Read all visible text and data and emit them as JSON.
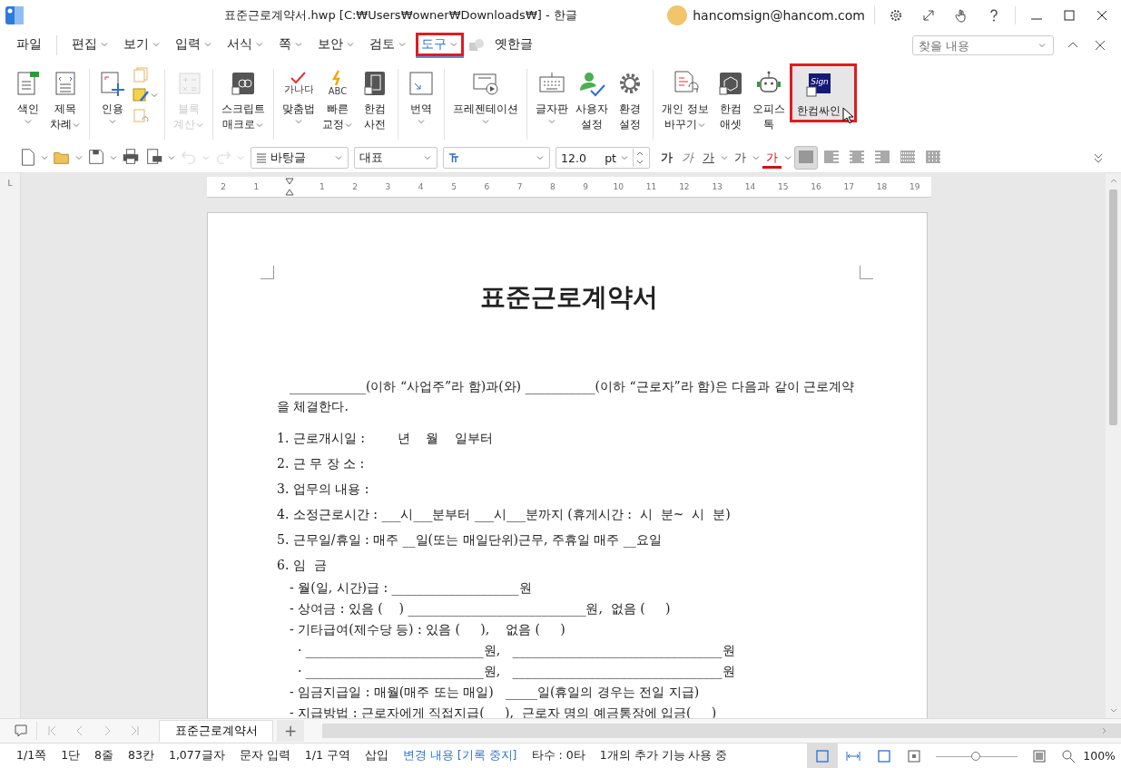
{
  "window": {
    "title": "표준근로계약서.hwp [C:₩Users₩owner₩Downloads₩] - 한글",
    "account": "hancomsign@hancom.com"
  },
  "menu": [
    {
      "label": "파일",
      "dropdown": false,
      "selected": false,
      "highlighted": false
    },
    {
      "label": "편집",
      "dropdown": true,
      "selected": false,
      "highlighted": false
    },
    {
      "label": "보기",
      "dropdown": true,
      "selected": false,
      "highlighted": false
    },
    {
      "label": "입력",
      "dropdown": true,
      "selected": false,
      "highlighted": false
    },
    {
      "label": "서식",
      "dropdown": true,
      "selected": false,
      "highlighted": false
    },
    {
      "label": "쪽",
      "dropdown": true,
      "selected": false,
      "highlighted": false
    },
    {
      "label": "보안",
      "dropdown": true,
      "selected": false,
      "highlighted": false
    },
    {
      "label": "검토",
      "dropdown": true,
      "selected": false,
      "highlighted": false
    },
    {
      "label": "도구",
      "dropdown": true,
      "selected": true,
      "highlighted": true
    },
    {
      "label": "옛한글",
      "dropdown": false,
      "selected": false,
      "highlighted": false
    }
  ],
  "search": {
    "placeholder": "찾을 내용"
  },
  "ribbon": [
    {
      "items": [
        {
          "kind": "large",
          "labels": [
            "색인"
          ],
          "dropdown": true,
          "disabled": false,
          "selected": false,
          "highlighted": false
        },
        {
          "kind": "large",
          "labels": [
            "제목",
            "차례"
          ],
          "dropdown": true,
          "disabled": false,
          "selected": false,
          "highlighted": false
        }
      ]
    },
    {
      "items": [
        {
          "kind": "large",
          "labels": [
            "인용"
          ],
          "dropdown": true,
          "disabled": false,
          "selected": false,
          "highlighted": false
        },
        {
          "kind": "stack",
          "dropdown": true
        }
      ]
    },
    {
      "items": [
        {
          "kind": "large",
          "labels": [
            "블록",
            "계산"
          ],
          "dropdown": true,
          "disabled": true,
          "selected": false,
          "highlighted": false
        }
      ]
    },
    {
      "items": [
        {
          "kind": "large",
          "labels": [
            "스크립트",
            "매크로"
          ],
          "dropdown": true,
          "disabled": false,
          "selected": false,
          "highlighted": false
        }
      ]
    },
    {
      "items": [
        {
          "kind": "large",
          "labels": [
            "맞춤법"
          ],
          "icon_text": "가나다",
          "dropdown": true,
          "disabled": false,
          "selected": false,
          "highlighted": false
        },
        {
          "kind": "large",
          "labels": [
            "빠른",
            "교정"
          ],
          "icon_text": "ABC",
          "dropdown": true,
          "disabled": false,
          "selected": false,
          "highlighted": false
        },
        {
          "kind": "large",
          "labels": [
            "한컴",
            "사전"
          ],
          "dropdown": false,
          "disabled": false,
          "selected": false,
          "highlighted": false
        }
      ]
    },
    {
      "items": [
        {
          "kind": "large",
          "labels": [
            "번역"
          ],
          "dropdown": true,
          "disabled": false,
          "selected": false,
          "highlighted": false
        }
      ]
    },
    {
      "items": [
        {
          "kind": "large",
          "labels": [
            "프레젠테이션"
          ],
          "dropdown": true,
          "disabled": false,
          "selected": false,
          "highlighted": false
        }
      ]
    },
    {
      "items": [
        {
          "kind": "large",
          "labels": [
            "글자판"
          ],
          "dropdown": true,
          "disabled": false,
          "selected": false,
          "highlighted": false
        },
        {
          "kind": "large",
          "labels": [
            "사용자",
            "설정"
          ],
          "dropdown": false,
          "disabled": false,
          "selected": false,
          "highlighted": false
        },
        {
          "kind": "large",
          "labels": [
            "환경",
            "설정"
          ],
          "dropdown": false,
          "disabled": false,
          "selected": false,
          "highlighted": false
        }
      ]
    },
    {
      "items": [
        {
          "kind": "large",
          "labels": [
            "개인 정보",
            "바꾸기"
          ],
          "dropdown": true,
          "disabled": false,
          "selected": false,
          "highlighted": false
        },
        {
          "kind": "large",
          "labels": [
            "한컴",
            "애셋"
          ],
          "dropdown": false,
          "disabled": false,
          "selected": false,
          "highlighted": false
        },
        {
          "kind": "large",
          "labels": [
            "오피스",
            "톡"
          ],
          "dropdown": false,
          "disabled": false,
          "selected": false,
          "highlighted": false
        },
        {
          "kind": "large",
          "labels": [
            "한컴싸인"
          ],
          "icon_text": "Sign",
          "dropdown": false,
          "disabled": false,
          "selected": true,
          "highlighted": true
        }
      ]
    }
  ],
  "quick_tools": [
    {
      "disabled": false
    },
    {
      "disabled": false
    },
    {
      "disabled": false
    },
    {
      "disabled": false
    },
    {
      "disabled": false
    },
    {
      "disabled": true
    },
    {
      "disabled": true
    }
  ],
  "format": {
    "style": "바탕글",
    "language": "대표",
    "size": "12.0",
    "unit": "pt",
    "char_buttons": [
      {
        "kind": "bold",
        "label": "가"
      },
      {
        "kind": "italic",
        "label": "가"
      },
      {
        "kind": "underline",
        "label": "가"
      },
      {
        "kind": "outline",
        "label": "가"
      },
      {
        "kind": "color",
        "label": "가"
      }
    ],
    "align": [
      {
        "selected": true
      },
      {
        "selected": false
      },
      {
        "selected": false
      },
      {
        "selected": false
      },
      {
        "selected": false
      },
      {
        "selected": false
      }
    ]
  },
  "ruler_corner": "L",
  "ruler": [
    "2",
    "1",
    "1",
    "2",
    "3",
    "4",
    "5",
    "6",
    "7",
    "8",
    "9",
    "10",
    "11",
    "12",
    "13",
    "14",
    "15",
    "16",
    "17",
    "18",
    "19"
  ],
  "document": {
    "title": "표준근로계약서",
    "intro": "____________(이하 “사업주”라 함)과(와) ___________(이하 “근로자”라 함)은 다음과 같이 근로계약을 체결한다.",
    "lines": [
      {
        "kind": "item",
        "text": "1. 근로개시일 :        년    월    일부터"
      },
      {
        "kind": "item",
        "text": "2. 근 무 장 소 :"
      },
      {
        "kind": "item",
        "text": "3. 업무의 내용 :"
      },
      {
        "kind": "item",
        "text": "4. 소정근로시간 : ___시___분부터 ___시___분까지 (휴게시간 :  시  분~  시  분)"
      },
      {
        "kind": "item",
        "text": "5. 근무일/휴일 : 매주 __일(또는 매일단위)근무, 주휴일 매주 __요일"
      },
      {
        "kind": "item",
        "text": "6. 임  금"
      },
      {
        "kind": "sub",
        "text": "- 월(일, 시간)급 : ____________________원"
      },
      {
        "kind": "sub",
        "text": "- 상여금 : 있음 (    ) ____________________________원,  없음 (     )"
      },
      {
        "kind": "sub",
        "text": "- 기타급여(제수당 등) : 있음 (     ),    없음 (     )"
      },
      {
        "kind": "sub",
        "text": "  · ____________________________원,   _________________________________원"
      },
      {
        "kind": "sub",
        "text": "  · ____________________________원,   _________________________________원"
      },
      {
        "kind": "sub",
        "text": "- 임금지급일 : 매월(매주 또는 매일)   _____일(휴일의 경우는 전일 지급)"
      },
      {
        "kind": "sub",
        "text": "- 지급방법 : 근로자에게 직접지급(     ),  근로자 명의 예금통장에 입금(     )"
      }
    ]
  },
  "doc_tabs": [
    {
      "label": "표준근로계약서",
      "selected": true
    }
  ],
  "new_tab": "+",
  "status_bar": [
    {
      "kind": "plain",
      "text": "1/1쪽"
    },
    {
      "kind": "plain",
      "text": "1단"
    },
    {
      "kind": "plain",
      "text": "8줄"
    },
    {
      "kind": "plain",
      "text": "83칸"
    },
    {
      "kind": "plain",
      "text": "1,077글자"
    },
    {
      "kind": "plain",
      "text": "문자 입력"
    },
    {
      "kind": "plain",
      "text": "1/1 구역"
    },
    {
      "kind": "plain",
      "text": "삽입"
    },
    {
      "kind": "link",
      "text": "변경 내용 [기록 중지]"
    },
    {
      "kind": "plain",
      "text": "타수 : 0타"
    },
    {
      "kind": "plain",
      "text": "1개의 추가 기능 사용 중"
    }
  ],
  "view_modes": [
    {
      "selected": true
    },
    {
      "selected": false
    },
    {
      "selected": false
    }
  ],
  "zoom": {
    "level": 0.49,
    "value": "100%"
  }
}
